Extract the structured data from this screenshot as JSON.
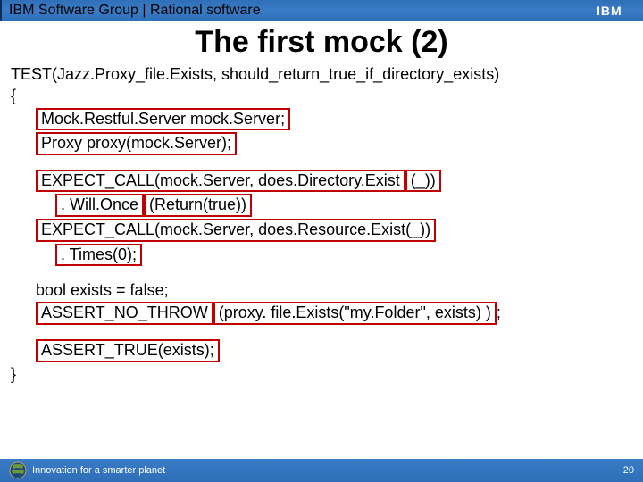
{
  "header": {
    "title": "IBM Software Group | Rational software",
    "logo_text": "IBM"
  },
  "slide": {
    "title": "The first mock (2)"
  },
  "code": {
    "test_sig": "TEST(Jazz.Proxy_file.Exists, should_return_true_if_directory_exists)",
    "brace_open": "{",
    "line1": "Mock.Restful.Server mock.Server;",
    "line2": "Proxy proxy(mock.Server);",
    "line3a": "EXPECT_CALL(mock.Server, does.Directory.Exist",
    "line3b": "(_))",
    "line4a": ". Will.Once",
    "line4b": "(Return(true))",
    "line5": "EXPECT_CALL(mock.Server, does.Resource.Exist(_))",
    "line6": ". Times(0);",
    "line7": "bool exists = false;",
    "line8a": "ASSERT_NO_THROW",
    "line8b": "(proxy. file.Exists(\"my.Folder\", exists) )",
    "line8c": ";",
    "line9": "ASSERT_TRUE(exists);",
    "brace_close": "}"
  },
  "footer": {
    "tagline": "Innovation for a smarter planet",
    "page_number": "20"
  }
}
